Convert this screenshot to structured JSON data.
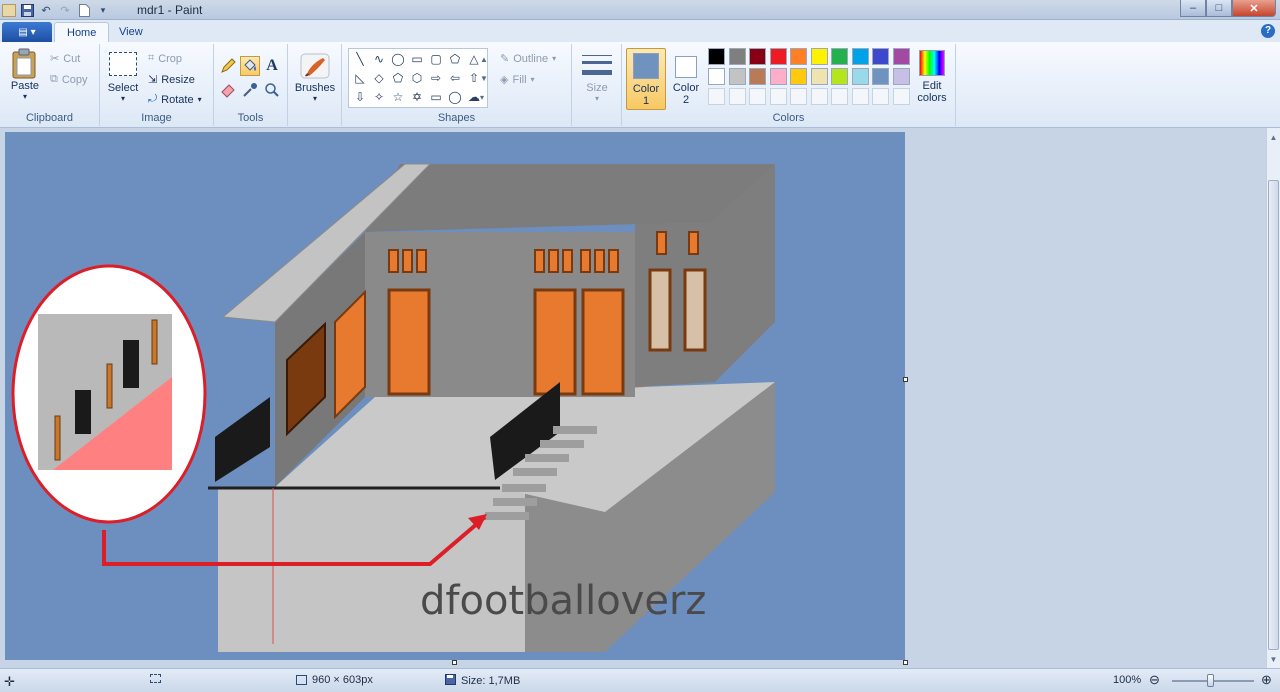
{
  "window": {
    "title": "mdr1 - Paint",
    "controls": {
      "minimize": "–",
      "maximize": "□",
      "close": "✕"
    }
  },
  "quick_access": [
    {
      "name": "save-icon",
      "glyph": "💾"
    },
    {
      "name": "undo-icon",
      "glyph": "↶"
    },
    {
      "name": "redo-icon",
      "glyph": "↷"
    },
    {
      "name": "new-file-icon",
      "glyph": "▯"
    },
    {
      "name": "customize-dropdown-icon",
      "glyph": "▾"
    }
  ],
  "ribbon": {
    "file_button": "▤ ▾",
    "tabs": [
      {
        "label": "Home",
        "active": true
      },
      {
        "label": "View",
        "active": false
      }
    ],
    "help": "?",
    "clipboard": {
      "label": "Clipboard",
      "paste": "Paste",
      "cut": "Cut",
      "copy": "Copy"
    },
    "image": {
      "label": "Image",
      "select": "Select",
      "crop": "Crop",
      "resize": "Resize",
      "rotate": "Rotate"
    },
    "tools": {
      "label": "Tools"
    },
    "brushes": {
      "label": "Brushes"
    },
    "shapes": {
      "label": "Shapes",
      "outline": "Outline",
      "fill": "Fill"
    },
    "size": {
      "label": "Size"
    },
    "colors": {
      "label": "Colors",
      "color1_label": "Color",
      "color1_num": "1",
      "color1_value": "#7092be",
      "color2_label": "Color",
      "color2_num": "2",
      "color2_value": "#ffffff",
      "edit_label": "Edit",
      "edit_label2": "colors",
      "palette_row1": [
        "#000000",
        "#7f7f7f",
        "#880015",
        "#ed1c24",
        "#ff7f27",
        "#fff200",
        "#22b14c",
        "#00a2e8",
        "#3f48cc",
        "#a349a4"
      ],
      "palette_row2": [
        "#ffffff",
        "#c3c3c3",
        "#b97a57",
        "#ffaec9",
        "#ffc90e",
        "#efe4b0",
        "#b5e61d",
        "#99d9ea",
        "#7092be",
        "#c8bfe7"
      ]
    }
  },
  "canvas": {
    "background": "#6d8fbf",
    "watermark": "dfootballoverz"
  },
  "statusbar": {
    "dimensions": "960 × 603px",
    "size": "Size: 1,7MB",
    "zoom": "100%"
  }
}
